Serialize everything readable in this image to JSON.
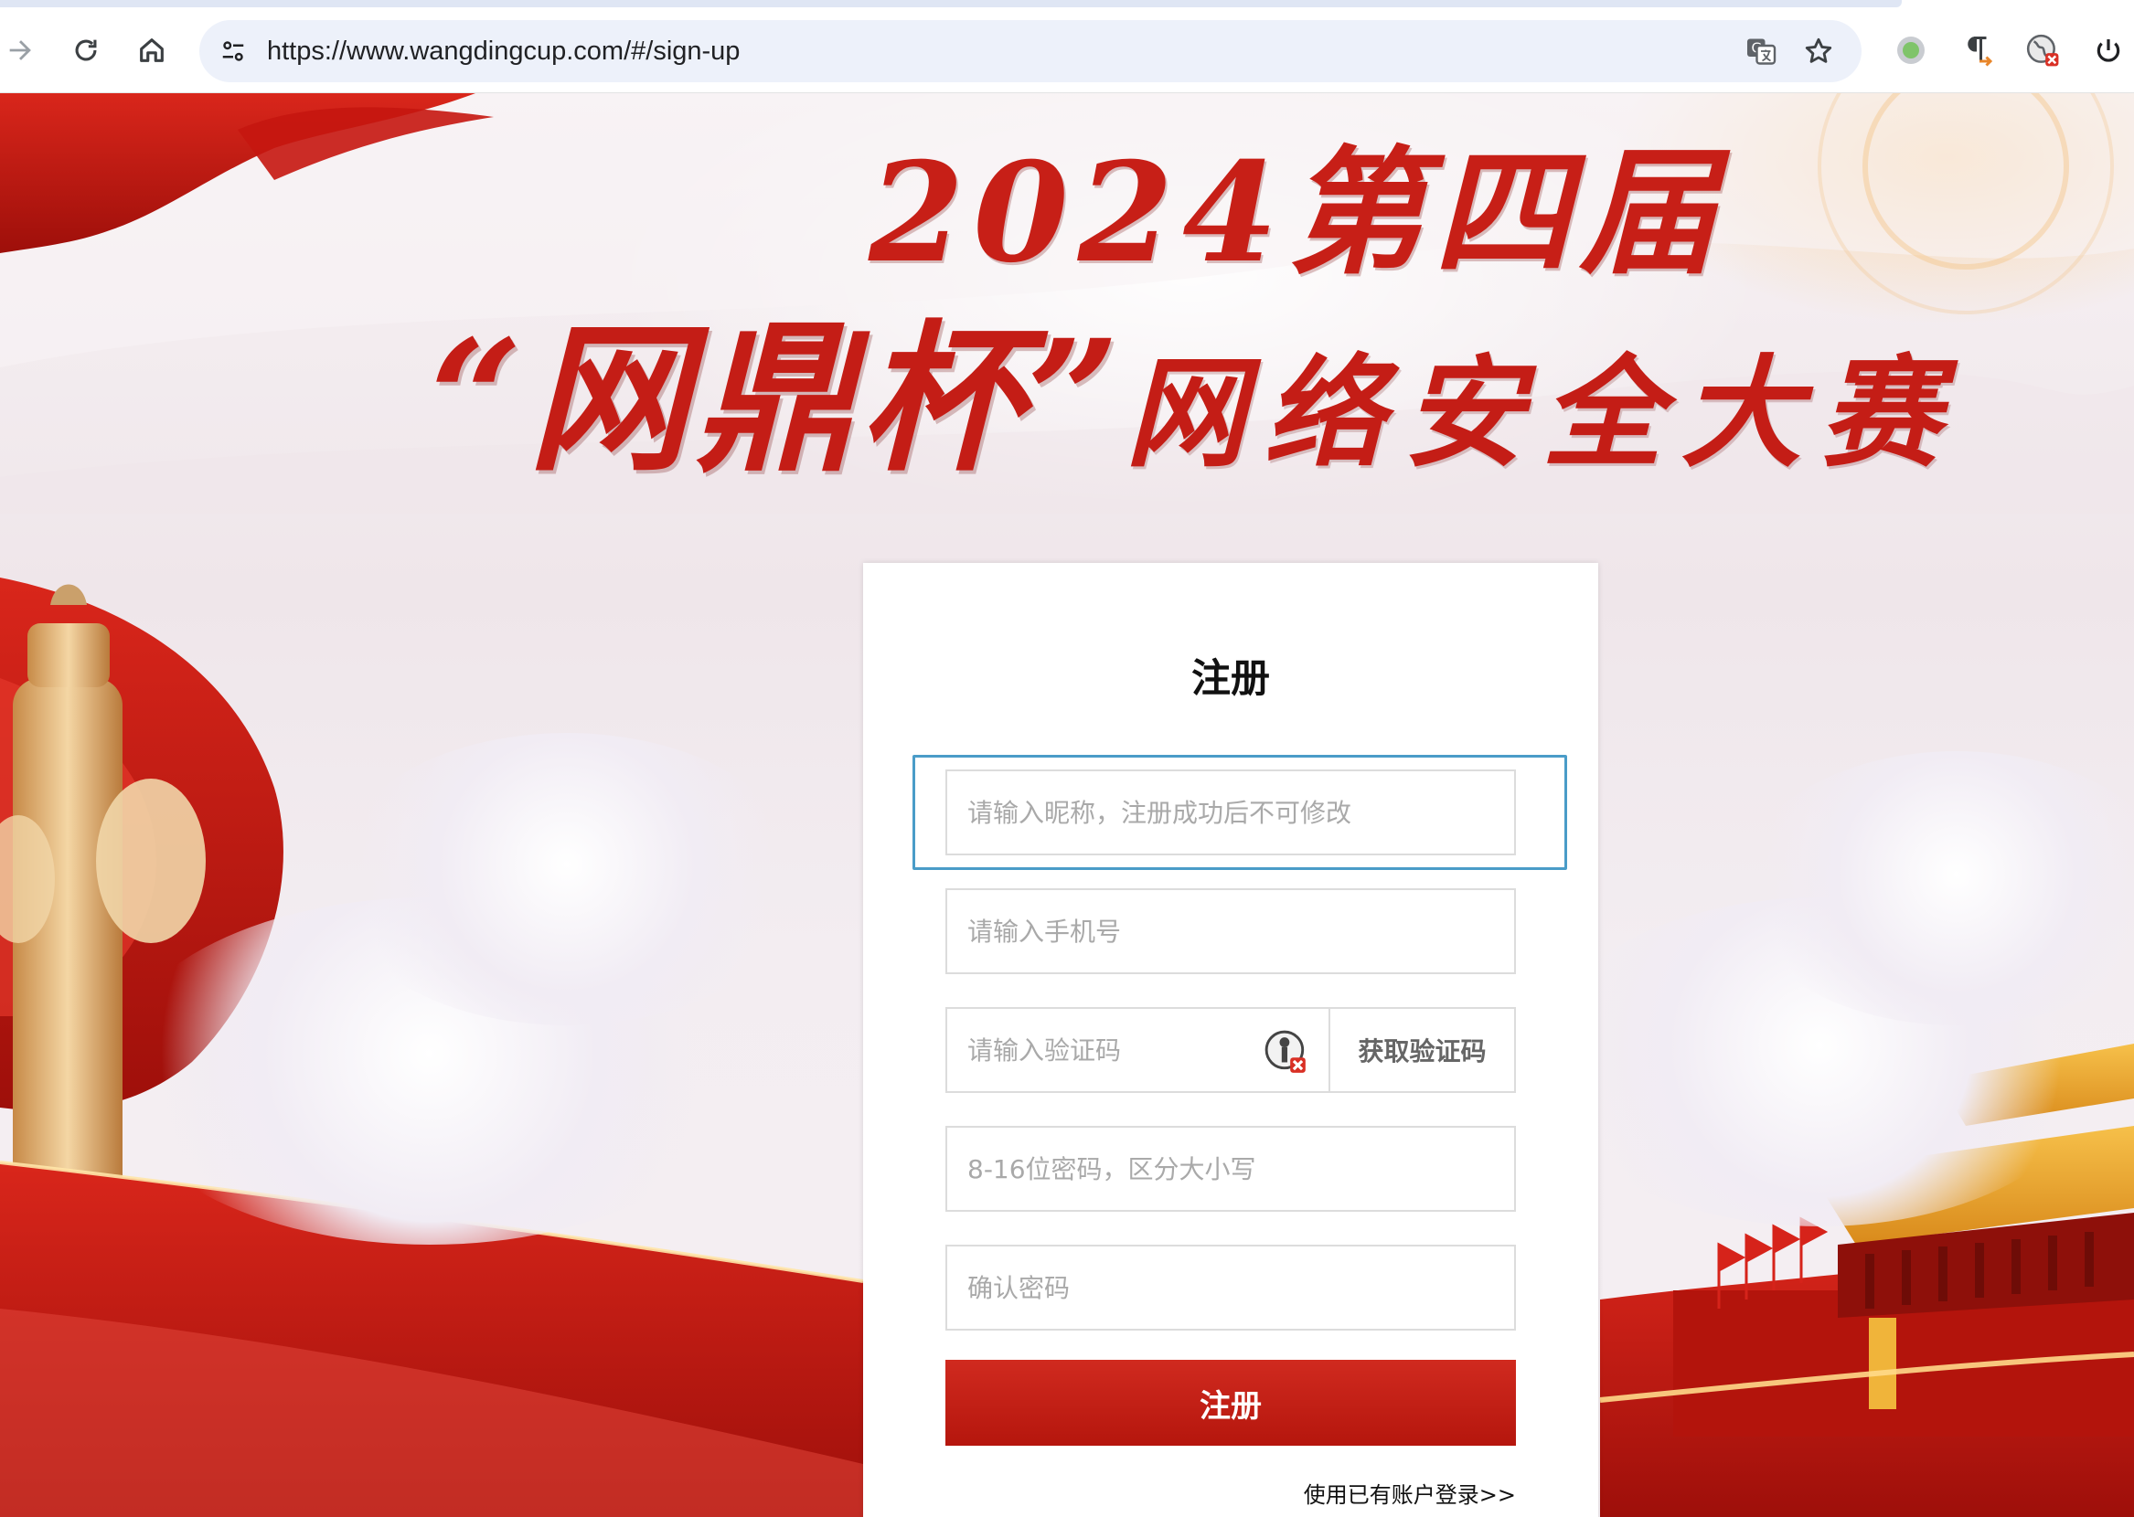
{
  "browser": {
    "url": "https://www.wangdingcup.com/#/sign-up",
    "icons": [
      "forward-icon",
      "reload-icon",
      "home-icon",
      "site-settings-icon",
      "translate-icon",
      "bookmark-star-icon",
      "extension-green-dot-icon",
      "extension-pilcrow-icon",
      "extension-globe-icon",
      "power-icon"
    ]
  },
  "banner": {
    "line1": "2024第四届",
    "line2_quoted": "“网鼎杯”",
    "line2_rest": "网络安全大赛"
  },
  "form": {
    "title": "注册",
    "fields": {
      "nickname_placeholder": "请输入昵称，注册成功后不可修改",
      "phone_placeholder": "请输入手机号",
      "code_placeholder": "请输入验证码",
      "password_placeholder": "8-16位密码，区分大小写",
      "confirm_placeholder": "确认密码"
    },
    "get_code_label": "获取验证码",
    "submit_label": "注册",
    "login_link": "使用已有账户登录>>"
  },
  "colors": {
    "accent_red": "#c41d16",
    "focus_ring": "#4a9cc8"
  }
}
